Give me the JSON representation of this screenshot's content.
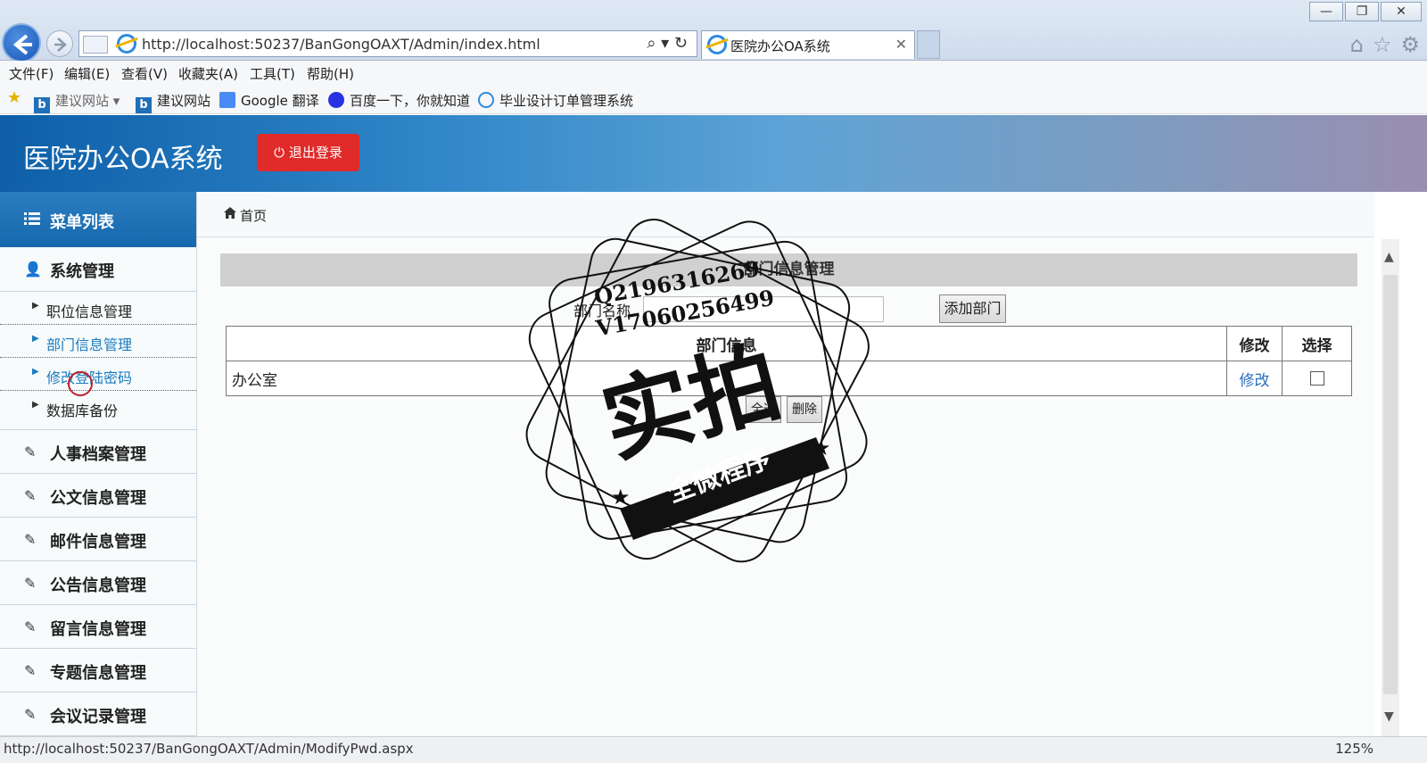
{
  "browser": {
    "url": "http://localhost:50237/BanGongOAXT/Admin/index.html",
    "tab_title": "医院办公OA系统",
    "tab_close": "✕",
    "window_buttons": [
      "—",
      "❐",
      "✕"
    ],
    "menu": [
      "文件(F)",
      "编辑(E)",
      "查看(V)",
      "收藏夹(A)",
      "工具(T)",
      "帮助(H)"
    ],
    "favorites": [
      "建议网站 ▾",
      "建议网站",
      "Google 翻译",
      "百度一下，你就知道",
      "毕业设计订单管理系统"
    ],
    "status_url": "http://localhost:50237/BanGongOAXT/Admin/ModifyPwd.aspx",
    "zoom": "125%"
  },
  "app": {
    "title": "医院办公OA系统",
    "logout_label": "退出登录"
  },
  "sidebar": {
    "header": "菜单列表",
    "system_group": "系统管理",
    "sub_items": [
      {
        "label": "职位信息管理"
      },
      {
        "label": "部门信息管理"
      },
      {
        "label": "修改登陆密码"
      },
      {
        "label": "数据库备份"
      }
    ],
    "groups": [
      {
        "label": "人事档案管理"
      },
      {
        "label": "公文信息管理"
      },
      {
        "label": "邮件信息管理"
      },
      {
        "label": "公告信息管理"
      },
      {
        "label": "留言信息管理"
      },
      {
        "label": "专题信息管理"
      },
      {
        "label": "会议记录管理"
      }
    ]
  },
  "main": {
    "breadcrumb": "首页",
    "panel_title": "部门信息管理",
    "dept_label": "部门名称",
    "dept_input_value": "",
    "add_button": "添加部门",
    "table": {
      "headers": [
        "部门信息",
        "修改",
        "选择"
      ],
      "rows": [
        {
          "name": "办公室",
          "edit": "修改",
          "selected": false
        }
      ]
    },
    "bottom_buttons": [
      "全选",
      "删除"
    ]
  },
  "watermark": {
    "line1": "Q2196316269",
    "line2": "V17060256499",
    "big_text": "实拍",
    "banner": "全微程序"
  }
}
